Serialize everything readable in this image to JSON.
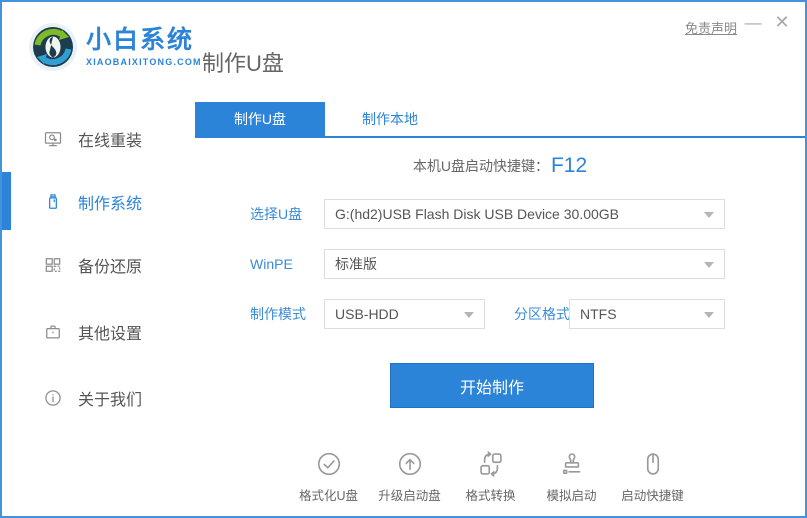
{
  "colors": {
    "accent": "#2b84d8",
    "window_border": "#4292dc",
    "text_gray": "#666666",
    "muted_gray": "#999999",
    "border_gray": "#dddddd"
  },
  "window": {
    "disclaimer_label": "免责声明",
    "minimize_glyph": "—",
    "close_glyph": "✕"
  },
  "header": {
    "logo_title": "小白系统",
    "logo_subtitle": "XIAOBAIXITONG.COM",
    "page_title": "制作U盘"
  },
  "sidebar": {
    "items": [
      {
        "label": "在线重装",
        "icon": "monitor-icon",
        "active": false
      },
      {
        "label": "制作系统",
        "icon": "usb-drive-icon",
        "active": true
      },
      {
        "label": "备份还原",
        "icon": "grid-icon",
        "active": false
      },
      {
        "label": "其他设置",
        "icon": "briefcase-icon",
        "active": false
      },
      {
        "label": "关于我们",
        "icon": "info-icon",
        "active": false
      }
    ]
  },
  "tabs": [
    {
      "label": "制作U盘",
      "active": true
    },
    {
      "label": "制作本地",
      "active": false
    }
  ],
  "main": {
    "hotkey_label": "本机U盘启动快捷键：",
    "hotkey_value": "F12",
    "form": {
      "usb_label": "选择U盘",
      "usb_value": "G:(hd2)USB Flash Disk USB Device 30.00GB",
      "winpe_label": "WinPE",
      "winpe_value": "标准版",
      "mode_label": "制作模式",
      "mode_value": "USB-HDD",
      "partition_label": "分区格式",
      "partition_value": "NTFS"
    },
    "start_button_label": "开始制作"
  },
  "footer": {
    "tools": [
      {
        "label": "格式化U盘",
        "icon": "check-circle-icon"
      },
      {
        "label": "升级启动盘",
        "icon": "arrow-up-circle-icon"
      },
      {
        "label": "格式转换",
        "icon": "convert-icon"
      },
      {
        "label": "模拟启动",
        "icon": "stamp-icon"
      },
      {
        "label": "启动快捷键",
        "icon": "mouse-icon"
      }
    ]
  }
}
